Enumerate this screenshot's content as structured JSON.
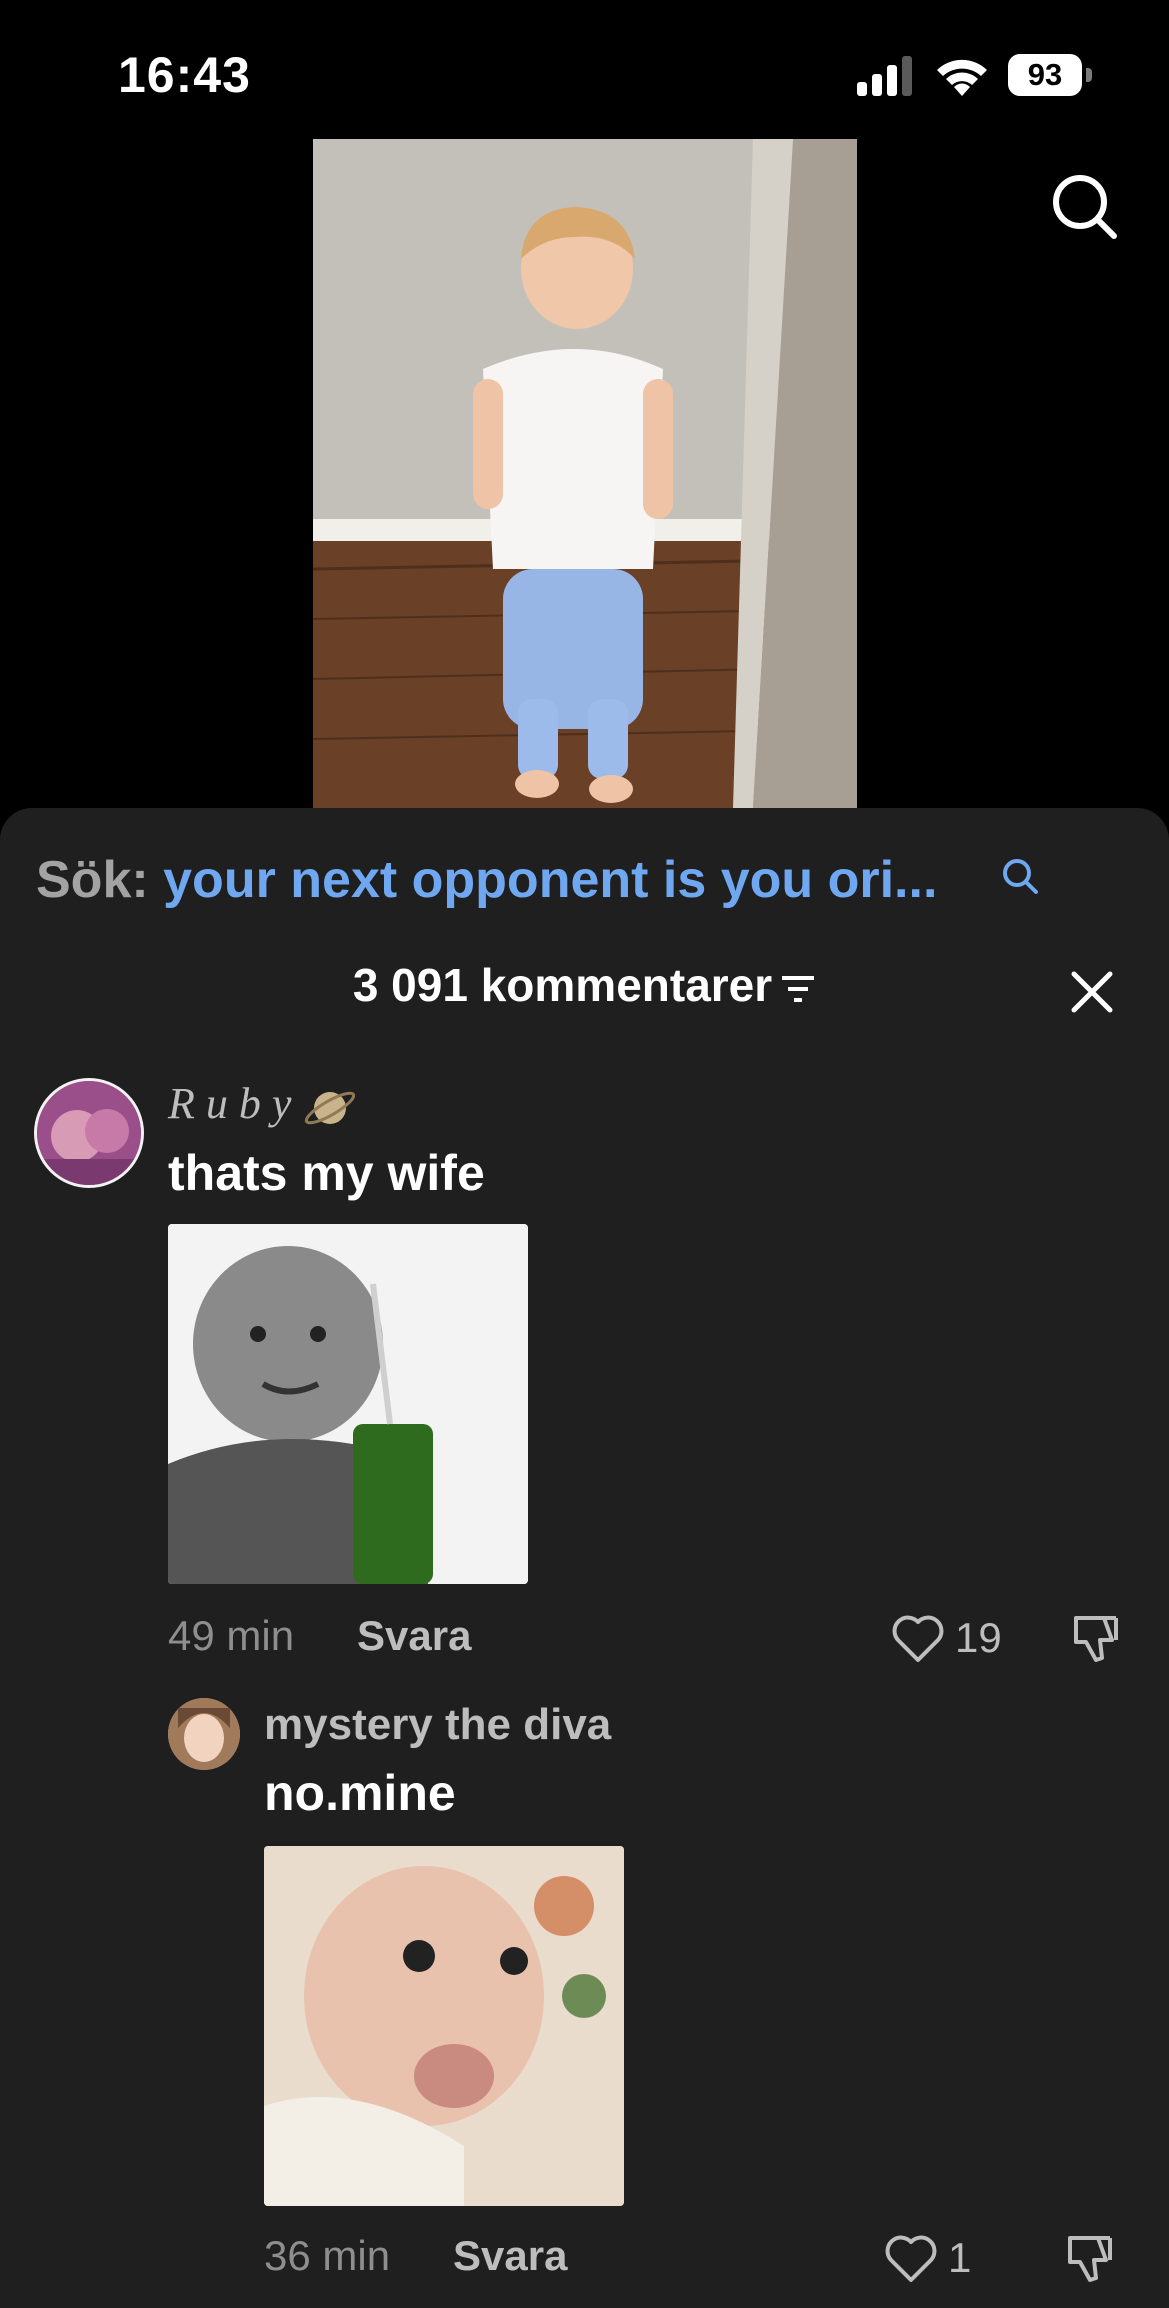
{
  "status": {
    "time": "16:43",
    "battery": "93"
  },
  "search": {
    "prefix": "Sök:",
    "query": "your next opponent is you ori..."
  },
  "comments_header": {
    "count_label": "3 091 kommentarer"
  },
  "comments": [
    {
      "user": "R u b y",
      "text": "thats my wife",
      "time": "49 min",
      "reply": "Svara",
      "likes": "19"
    },
    {
      "user": "mystery the diva",
      "text": "no.mine",
      "time": "36 min",
      "reply": "Svara",
      "likes": "1"
    }
  ],
  "icons": {
    "search": "search-icon",
    "close": "close-icon",
    "filter": "filter-icon",
    "like": "heart-icon",
    "dislike": "thumbs-down-icon",
    "planet": "planet-icon"
  }
}
